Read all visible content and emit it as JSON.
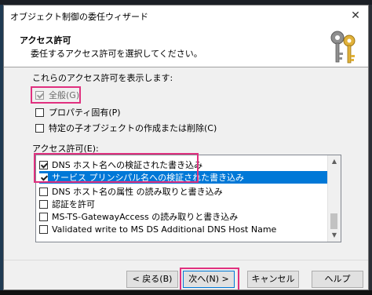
{
  "window": {
    "title": "オブジェクト制御の委任ウィザード",
    "close_glyph": "✕"
  },
  "header": {
    "title": "アクセス許可",
    "subtitle": "委任するアクセス許可を選択してください。",
    "icon": "keys-icon"
  },
  "show_section": {
    "label": "これらのアクセス許可を表示します:",
    "options": [
      {
        "label": "全般(G)",
        "checked": true,
        "grayed": true
      },
      {
        "label": "プロパティ固有(P)",
        "checked": false
      },
      {
        "label": "特定の子オブジェクトの作成または削除(C)",
        "checked": false
      }
    ]
  },
  "permissions": {
    "label": "アクセス許可(E):",
    "items": [
      {
        "label": "DNS ホスト名への検証された書き込み",
        "checked": true,
        "selected": false
      },
      {
        "label": "サービス プリンシパル名への検証された書き込み",
        "checked": true,
        "selected": true
      },
      {
        "label": "DNS ホスト名の属性 の読み取りと書き込み",
        "checked": false,
        "selected": false
      },
      {
        "label": "認証を許可",
        "checked": false,
        "selected": false
      },
      {
        "label": "MS-TS-GatewayAccess の読み取りと書き込み",
        "checked": false,
        "selected": false
      },
      {
        "label": "Validated write to MS DS Additional DNS Host Name",
        "checked": false,
        "selected": false
      }
    ]
  },
  "buttons": {
    "back": "< 戻る(B)",
    "next": "次へ(N) >",
    "cancel": "キャンセル",
    "help": "ヘルプ"
  },
  "colors": {
    "highlight": "#e0307f",
    "selection": "#0078d7"
  }
}
